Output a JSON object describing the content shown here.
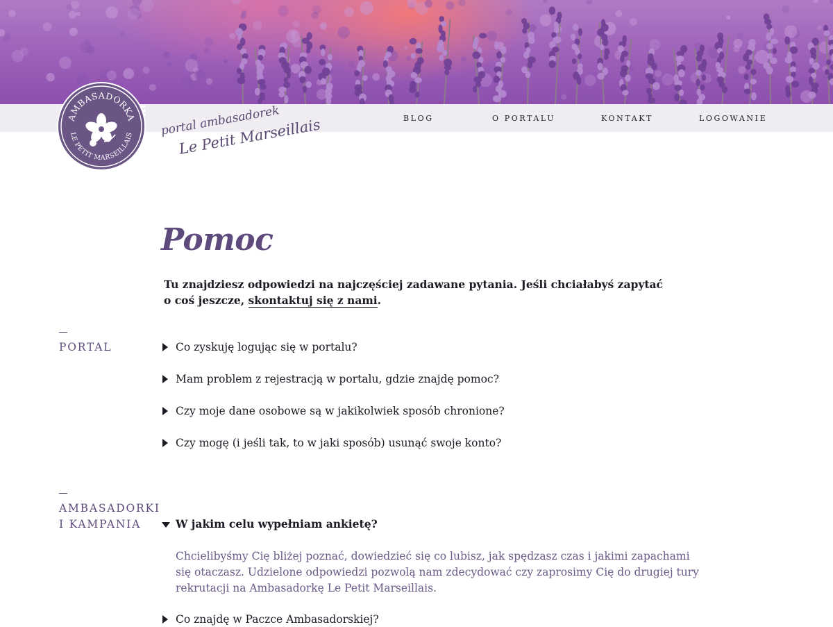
{
  "brand": {
    "badge_top_text": "AMBASADORKA",
    "badge_bottom_text": "LE PETIT MARSEILLAIS",
    "tagline_line1": "portal ambasadorek",
    "tagline_line2": "Le Petit Marseillais"
  },
  "nav": {
    "items": [
      {
        "label": "BLOG"
      },
      {
        "label": "O PORTALU"
      },
      {
        "label": "KONTAKT"
      },
      {
        "label": "LOGOWANIE"
      }
    ]
  },
  "page": {
    "title": "Pomoc",
    "intro_text": "Tu znajdziesz odpowiedzi na najczęściej zadawane pytania. Jeśli chciałabyś zapytać o coś jeszcze, ",
    "intro_link": "skontaktuj się z nami",
    "intro_end": "."
  },
  "sections": [
    {
      "label_line1": "PORTAL",
      "questions": [
        {
          "text": "Co zyskuję logując się w portalu?"
        },
        {
          "text": "Mam problem z rejestracją w portalu, gdzie znajdę pomoc?"
        },
        {
          "text": "Czy moje dane osobowe są w jakikolwiek sposób chronione?"
        },
        {
          "text": "Czy mogę (i jeśli tak, to w jaki sposób) usunąć swoje konto?"
        }
      ]
    },
    {
      "label_line1": "AMBASADORKI",
      "label_line2": "I KAMPANIA",
      "questions": [
        {
          "text": "W jakim celu wypełniam ankietę?",
          "expanded": true,
          "answer": "Chcielibyśmy Cię bliżej poznać, dowiedzieć się co lubisz, jak spędzasz czas i jakimi zapachami się otaczasz. Udzielone odpowiedzi pozwolą nam zdecydować czy zaprosimy Cię do drugiej tury rekrutacji na Ambasadorkę Le Petit Marseillais."
        },
        {
          "text": "Co znajdę w Paczce Ambasadorskiej?"
        }
      ]
    }
  ],
  "colors": {
    "accent_purple": "#5e4a7c",
    "answer_text": "#6b5a88",
    "nav_bar_bg": "#efedf2"
  },
  "icons": [
    "caret-right-icon",
    "caret-down-icon",
    "flower-icon"
  ]
}
